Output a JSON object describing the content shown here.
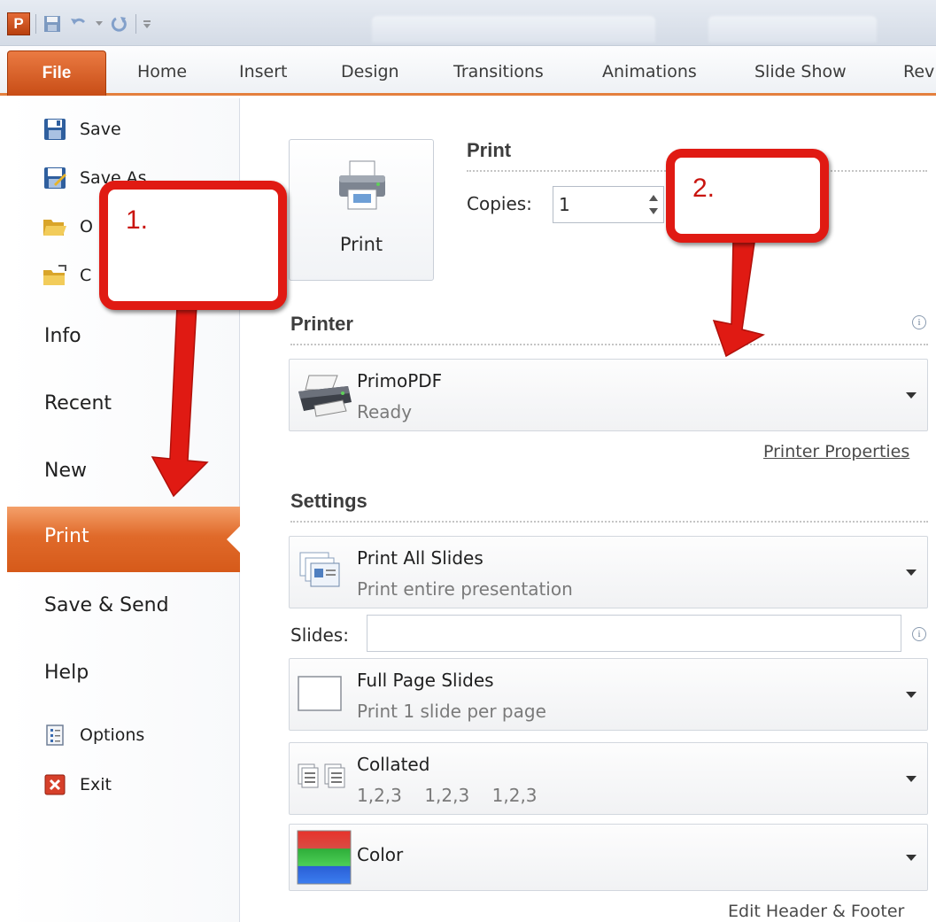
{
  "quick_access": {
    "logo_letter": "P"
  },
  "ribbon": {
    "file_tab": "File",
    "tabs": [
      "Home",
      "Insert",
      "Design",
      "Transitions",
      "Animations",
      "Slide Show",
      "Rev"
    ]
  },
  "nav": {
    "commands": [
      {
        "label": "Save",
        "icon": "save-icon"
      },
      {
        "label": "Save As",
        "icon": "save-as-icon"
      },
      {
        "label": "O",
        "icon": "open-folder-icon"
      },
      {
        "label": "C",
        "icon": "close-folder-icon"
      }
    ],
    "sections": [
      "Info",
      "Recent",
      "New",
      "Print",
      "Save & Send",
      "Help"
    ],
    "options_label": "Options",
    "exit_label": "Exit"
  },
  "print": {
    "button_label": "Print",
    "title": "Print",
    "copies_label": "Copies:",
    "copies_value": "1"
  },
  "printer": {
    "title": "Printer",
    "name": "PrimoPDF",
    "status": "Ready",
    "properties_link": "Printer Properties"
  },
  "settings": {
    "title": "Settings",
    "slides_label": "Slides:",
    "slides_value": "",
    "options": [
      {
        "title": "Print All Slides",
        "subtitle": "Print entire presentation",
        "icon": "print-all-slides-icon"
      },
      {
        "title": "Full Page Slides",
        "subtitle": "Print 1 slide per page",
        "icon": "full-page-slide-icon"
      },
      {
        "title": "Collated",
        "subtitle": "1,2,3    1,2,3    1,2,3",
        "icon": "collated-icon"
      },
      {
        "title": "Color",
        "subtitle": "",
        "icon": "color-swatch-icon"
      }
    ],
    "edit_header_footer": "Edit Header & Footer"
  },
  "annotations": {
    "callout_1": "1.",
    "callout_2": "2.",
    "color": "#e01a13"
  },
  "colors": {
    "accent": "#d65a1a",
    "file_tab": "#c84d16"
  }
}
